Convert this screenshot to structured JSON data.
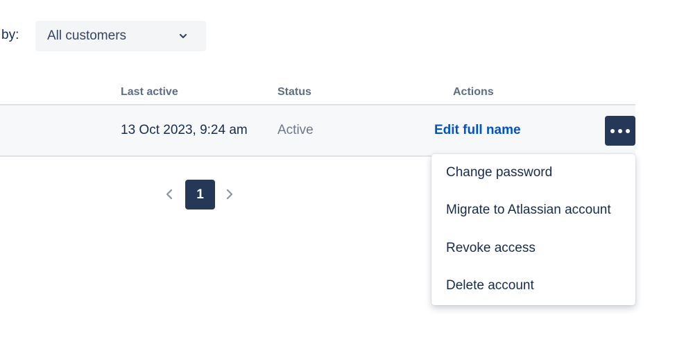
{
  "filter": {
    "label": "by:",
    "selected": "All customers",
    "icon": "chevron-down-icon"
  },
  "table": {
    "columns": {
      "last_active": "Last active",
      "status": "Status",
      "actions": "Actions"
    },
    "row": {
      "last_active": "13 Oct 2023, 9:24 am",
      "status": "Active",
      "action_link": "Edit full name",
      "more_icon": "more-horizontal-icon"
    }
  },
  "pagination": {
    "current_page": "1",
    "prev_icon": "chevron-left-icon",
    "next_icon": "chevron-right-icon"
  },
  "menu": {
    "items": [
      {
        "label": "Change password"
      },
      {
        "label": "Migrate to Atlassian account"
      },
      {
        "label": "Revoke access"
      },
      {
        "label": "Delete account"
      }
    ]
  },
  "colors": {
    "primary_dark": "#253858",
    "link": "#0052cc",
    "text": "#172b4d",
    "muted": "#6b778c"
  }
}
